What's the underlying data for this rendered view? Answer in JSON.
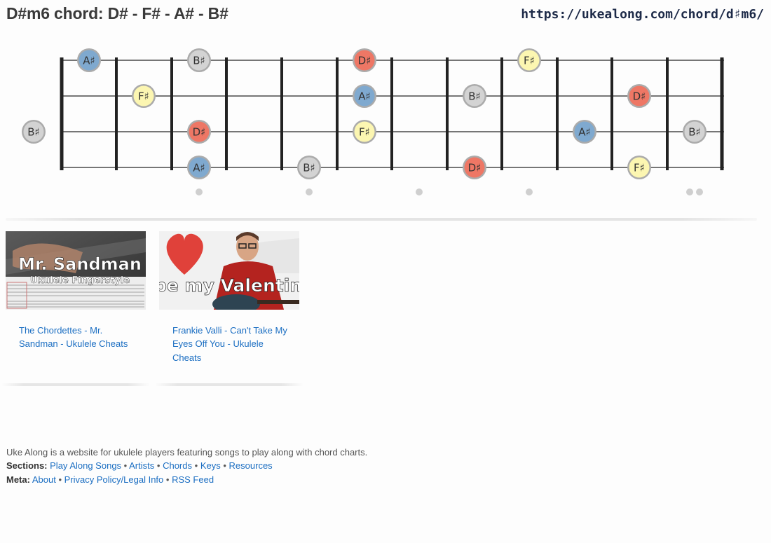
{
  "header": {
    "title": "D#m6 chord: D# - F# - A# - B#",
    "url": "https://ukealong.com/chord/d♯m6/"
  },
  "fretboard": {
    "notes": [
      {
        "label": "A♯",
        "string": 0,
        "fret": 1,
        "color": "#7fa9cf"
      },
      {
        "label": "B♯",
        "string": 0,
        "fret": 3,
        "color": "#d3d3d3"
      },
      {
        "label": "D♯",
        "string": 0,
        "fret": 6,
        "color": "#ee7765"
      },
      {
        "label": "F♯",
        "string": 0,
        "fret": 9,
        "color": "#fcf6b1"
      },
      {
        "label": "F♯",
        "string": 1,
        "fret": 2,
        "color": "#fcf6b1"
      },
      {
        "label": "A♯",
        "string": 1,
        "fret": 6,
        "color": "#7fa9cf"
      },
      {
        "label": "B♯",
        "string": 1,
        "fret": 8,
        "color": "#d3d3d3"
      },
      {
        "label": "D♯",
        "string": 1,
        "fret": 11,
        "color": "#ee7765"
      },
      {
        "label": "B♯",
        "string": 2,
        "fret": 0,
        "color": "#d3d3d3"
      },
      {
        "label": "D♯",
        "string": 2,
        "fret": 3,
        "color": "#ee7765"
      },
      {
        "label": "F♯",
        "string": 2,
        "fret": 6,
        "color": "#fcf6b1"
      },
      {
        "label": "A♯",
        "string": 2,
        "fret": 10,
        "color": "#7fa9cf"
      },
      {
        "label": "B♯",
        "string": 2,
        "fret": 12,
        "color": "#d3d3d3"
      },
      {
        "label": "A♯",
        "string": 3,
        "fret": 3,
        "color": "#7fa9cf"
      },
      {
        "label": "B♯",
        "string": 3,
        "fret": 5,
        "color": "#d3d3d3"
      },
      {
        "label": "D♯",
        "string": 3,
        "fret": 8,
        "color": "#ee7765"
      },
      {
        "label": "F♯",
        "string": 3,
        "fret": 11,
        "color": "#fcf6b1"
      }
    ],
    "single_dot_frets": [
      3,
      5,
      7,
      9
    ],
    "double_dot_fret": 12
  },
  "cards": [
    {
      "thumb_title": "Mr. Sandman",
      "thumb_subtitle": "Ukulele Fingerstyle",
      "caption": "The Chordettes - Mr. Sandman - Ukulele Cheats"
    },
    {
      "thumb_title": "...be my Valentine?",
      "caption": "Frankie Valli - Can't Take My Eyes Off You - Ukulele Cheats"
    }
  ],
  "footer": {
    "about_text": "Uke Along is a website for ukulele players featuring songs to play along with chord charts.",
    "sections_label": "Sections:",
    "sections": [
      "Play Along Songs",
      "Artists",
      "Chords",
      "Keys",
      "Resources"
    ],
    "meta_label": "Meta:",
    "meta": [
      "About",
      "Privacy Policy/Legal Info",
      "RSS Feed"
    ],
    "separator": "•"
  }
}
